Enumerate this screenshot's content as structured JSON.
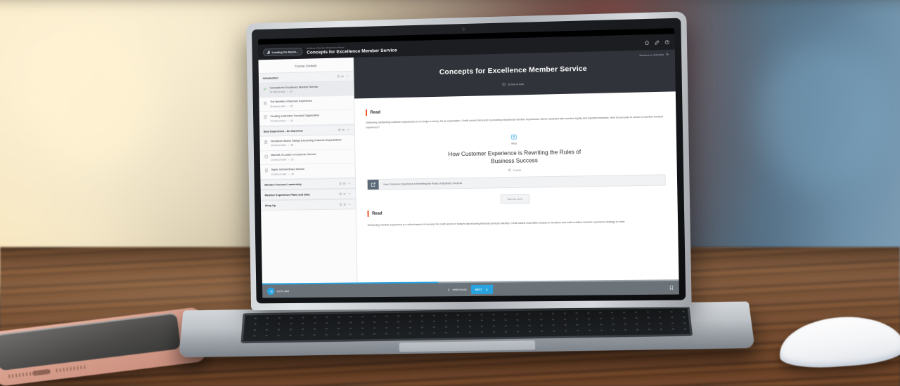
{
  "scene": {
    "description": "Laptop on a wooden desk displaying an e-learning course page, with a rose-gold smartphone at left and a white mouse at right",
    "devices": [
      "laptop",
      "smartphone",
      "mouse"
    ]
  },
  "appbar": {
    "brand_label": "Leading the Busin...",
    "brand_icon": "book-icon",
    "breadcrumb": "Building a Member Experience Focus",
    "page_title": "Concepts for Excellence Member Service",
    "icons": [
      {
        "name": "home-icon",
        "label": "Home"
      },
      {
        "name": "edit-pencil-icon",
        "label": "Edit"
      },
      {
        "name": "help-circle-icon",
        "label": "Help"
      }
    ]
  },
  "sidebar": {
    "title": "Course Content",
    "sections": [
      {
        "name": "Introduction",
        "points": "80",
        "expanded": true,
        "chevron": "chevron-up-icon",
        "lessons": [
          {
            "title": "Concepts for Excellence Member Service",
            "duration": "15 mins of work",
            "points": "50",
            "status": "complete",
            "icon": "check-icon",
            "active": true
          },
          {
            "title": "The Benefits of Member Experience",
            "duration": "15 mins of work",
            "points": "35",
            "status": "incomplete",
            "icon": "document-icon",
            "active": false
          },
          {
            "title": "Creating a Member-Focused Organization",
            "duration": "10 mins of work",
            "points": "35",
            "status": "incomplete",
            "icon": "document-icon",
            "active": false
          }
        ]
      },
      {
        "name": "Best Experience - An Overview",
        "points": "85",
        "expanded": true,
        "chevron": "chevron-up-icon",
        "lessons": [
          {
            "title": "Nordstrom Brand: Always Exceeding Customer Expectations",
            "duration": "20 mins of work",
            "points": "35",
            "status": "incomplete",
            "icon": "document-icon",
            "active": false
          },
          {
            "title": "Marriott: A Leader in Customer Service",
            "duration": "10 mins of work",
            "points": "15",
            "status": "incomplete",
            "icon": "document-icon",
            "active": false
          },
          {
            "title": "Apple: Extraordinary Service",
            "duration": "15 mins of work",
            "points": "35",
            "status": "incomplete",
            "icon": "document-icon",
            "active": false
          }
        ]
      },
      {
        "name": "Member Focused Leadership",
        "points": "80",
        "expanded": false,
        "chevron": "chevron-down-icon",
        "lessons": []
      },
      {
        "name": "Member Experience Plans and Data",
        "points": "70",
        "expanded": false,
        "chevron": "chevron-down-icon",
        "lessons": []
      },
      {
        "name": "Wrap Up",
        "points": "35",
        "expanded": false,
        "chevron": "chevron-down-icon",
        "lessons": []
      }
    ]
  },
  "hero": {
    "released_label": "Released on 10/31/2023",
    "released_icon": "gear-icon",
    "title": "Concepts for Excellence Member Service",
    "duration": "15 mins of work",
    "duration_icon": "clock-icon",
    "bg_color": "#30333a"
  },
  "content": {
    "block_one": {
      "heading": "Read",
      "accent_color": "#e8562a",
      "paragraph": "Delivering outstanding customer experiences is no longer a luxury; it's an expectation. Credit unions that excel in providing exceptional member experiences will be rewarded with member loyalty and repeated business. How do you plan to ensure a member-focused experience?"
    },
    "read_marker": {
      "icon": "read-book-icon",
      "label": "Read",
      "color": "#4fb3e8"
    },
    "article": {
      "title": "How Customer Experience is Rewriting the Rules of Business Success",
      "points": "3 points",
      "points_icon": "star-icon",
      "link_label": "How Customer Experience is Rewriting the Rules of Business Success",
      "link_icon": "external-link-icon"
    },
    "mark_done_label": "Mark as Done",
    "block_two": {
      "heading": "Read",
      "accent_color": "#e8562a",
      "paragraph": "Enhancing member experience is a critical aspect of success for credit unions in today's fast-evolving financial services industry. Credit unions must listen closely to members and craft a unified member experience strategy to meet"
    }
  },
  "footer": {
    "outline_label": "OUTLINE",
    "outline_icon": "list-icon",
    "previous_label": "PREVIOUS",
    "previous_icon": "chevron-left-icon",
    "next_label": "NEXT",
    "next_icon": "chevron-right-icon",
    "bookmark_icon": "bookmark-icon",
    "accent_color": "#29a3e0",
    "progress_percent": "43"
  }
}
